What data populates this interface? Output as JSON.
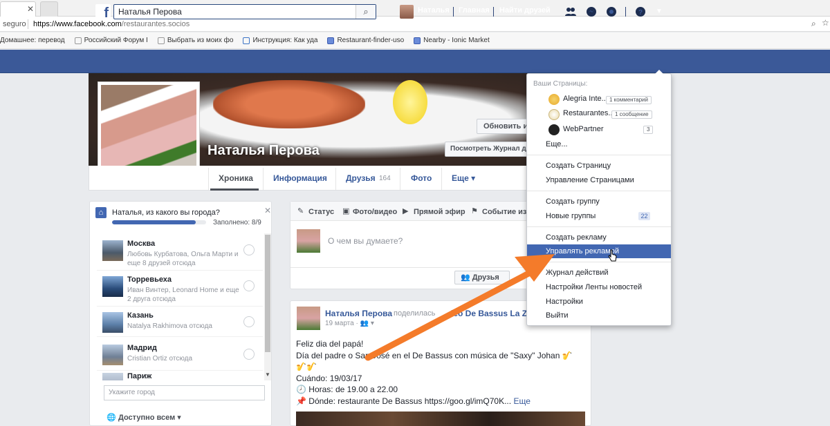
{
  "browser": {
    "security_label": "seguro",
    "url_host": "https://www.facebook.com",
    "url_path": "/restaurantes.socios",
    "bookmarks": [
      "Домашнее: перевод",
      "Российский Форум I",
      "Выбрать из моих фо",
      "Инструкция: Как уда",
      "Restaurant-finder-uso",
      "Nearby - Ionic Market"
    ]
  },
  "fb": {
    "search_value": "Наталья Перова",
    "nav_user": "Наталья",
    "nav_home": "Главная",
    "nav_find_friends": "Найти друзей",
    "brand_color": "#3b5998"
  },
  "profile": {
    "name": "Наталья Перова",
    "update_info": "Обновить ин",
    "view_activity_log": "Посмотреть Журнал д",
    "tabs": [
      {
        "label": "Хроника"
      },
      {
        "label": "Информация"
      },
      {
        "label": "Друзья",
        "count": "164"
      },
      {
        "label": "Фото"
      },
      {
        "label": "Еще ▾"
      }
    ]
  },
  "city_card": {
    "question": "Наталья, из какого вы города?",
    "progress_fraction": 0.889,
    "progress_label": "Заполнено: 8/9",
    "cities": [
      {
        "name": "Москва",
        "sub": "Любовь Курбатова, Ольга Марти и еще 8 друзей отсюда"
      },
      {
        "name": "Торревьеха",
        "sub": "Иван Винтер, Leonard Home и еще 2 друга отсюда"
      },
      {
        "name": "Казань",
        "sub": "Natalya Rakhimova отсюда"
      },
      {
        "name": "Мадрид",
        "sub": "Cristian Ortiz отсюда"
      },
      {
        "name": "Париж",
        "sub": ""
      }
    ],
    "input_placeholder": "Укажите город",
    "privacy": "Доступно всем ▾"
  },
  "composer": {
    "tabs": [
      "Статус",
      "Фото/видео",
      "Прямой эфир",
      "Событие из ж"
    ],
    "placeholder": "О чем вы думаете?",
    "audience": "Друзья"
  },
  "post": {
    "author": "Наталья Перова",
    "action": "поделилась",
    "target": "deo De Bassus La Z",
    "date": "19 марта · ",
    "lines": [
      "Feliz dia del papá!",
      "Día del padre o San José en el De Bassus con música de \"Saxy\" Johan 🎷",
      "🎷🎷",
      "Cuándo: 19/03/17",
      "🕗 Horas: de 19.00 a 22.00",
      "📌 Dónde: restaurante De Bassus https://goo.gl/imQ70K..."
    ],
    "more": "Еще"
  },
  "dropdown": {
    "your_pages": "Ваши Страницы:",
    "pages": [
      {
        "name": "Alegria Inte...",
        "badge": "1 комментарий"
      },
      {
        "name": "Restaurantes...",
        "badge": "1 сообщение"
      },
      {
        "name": "WebPartner",
        "badge": "3"
      }
    ],
    "more": "Еще...",
    "create_page": "Создать Страницу",
    "manage_pages": "Управление Страницами",
    "create_group": "Создать группу",
    "new_groups": "Новые группы",
    "new_groups_count": "22",
    "create_ad": "Создать рекламу",
    "manage_ads": "Управлять рекламой",
    "activity_log": "Журнал действий",
    "news_feed_settings": "Настройки Ленты новостей",
    "settings": "Настройки",
    "logout": "Выйти"
  },
  "colors": {
    "arrow": "#f47b2a",
    "highlight": "#4267b2"
  }
}
